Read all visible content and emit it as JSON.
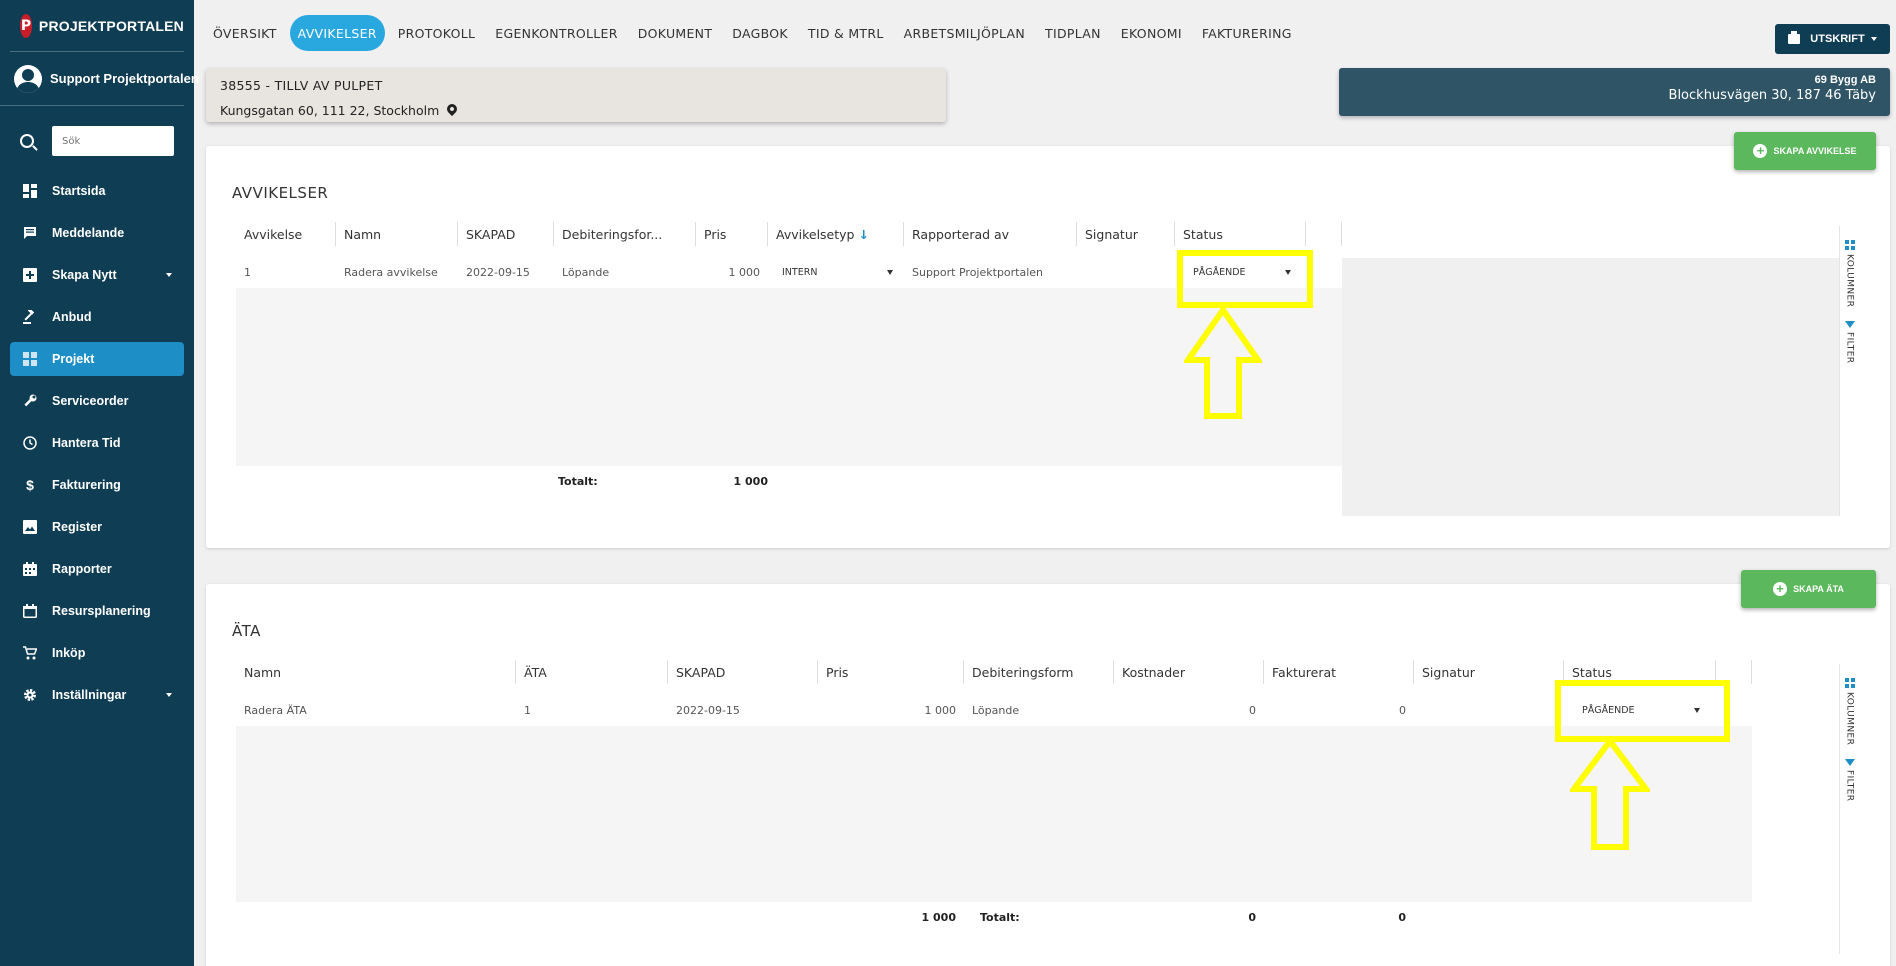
{
  "sidebar": {
    "brand": "PROJEKTPORTALEN",
    "brand_logo": "P",
    "user_name": "Support Projektportalen",
    "search_placeholder": "Sök",
    "items": [
      {
        "label": "Startsida",
        "icon": "dashboard-icon"
      },
      {
        "label": "Meddelande",
        "icon": "message-icon"
      },
      {
        "label": "Skapa Nytt",
        "icon": "add-box-icon",
        "caret": true
      },
      {
        "label": "Anbud",
        "icon": "gavel-icon"
      },
      {
        "label": "Projekt",
        "icon": "project-icon",
        "active": true
      },
      {
        "label": "Serviceorder",
        "icon": "wrench-icon"
      },
      {
        "label": "Hantera Tid",
        "icon": "clock-icon"
      },
      {
        "label": "Fakturering",
        "icon": "dollar-icon"
      },
      {
        "label": "Register",
        "icon": "image-icon"
      },
      {
        "label": "Rapporter",
        "icon": "calendar-grid-icon"
      },
      {
        "label": "Resursplanering",
        "icon": "calendar-icon"
      },
      {
        "label": "Inköp",
        "icon": "cart-icon"
      },
      {
        "label": "Inställningar",
        "icon": "gear-icon",
        "caret": true
      }
    ]
  },
  "topnav": {
    "tabs": [
      "ÖVERSIKT",
      "AVVIKELSER",
      "PROTOKOLL",
      "EGENKONTROLLER",
      "DOKUMENT",
      "DAGBOK",
      "TID & MTRL",
      "ARBETSMILJÖPLAN",
      "TIDPLAN",
      "EKONOMI",
      "FAKTURERING"
    ],
    "active_tab": "AVVIKELSER",
    "print_label": "UTSKRIFT"
  },
  "project": {
    "title": "38555 - TILLV AV PULPET",
    "address": "Kungsgatan 60, 111 22, Stockholm"
  },
  "company": {
    "name": "69 Bygg AB",
    "address": "Blockhusvägen 30, 187 46 Täby"
  },
  "avvikelser": {
    "title": "AVVIKELSER",
    "create_label": "SKAPA AVVIKELSE",
    "columns": [
      "Avvikelse",
      "Namn",
      "SKAPAD",
      "Debiteringsfor...",
      "Pris",
      "Avvikelsetyp",
      "Rapporterad av",
      "Signatur",
      "Status"
    ],
    "sort_arrow": "↓",
    "row": {
      "avvikelse": "1",
      "namn": "Radera avvikelse",
      "skapad": "2022-09-15",
      "debitering": "Löpande",
      "pris": "1 000",
      "typ": "INTERN",
      "rapporterad": "Support Projektportalen",
      "signatur": "",
      "status": "PÅGÅENDE"
    },
    "total_label": "Totalt:",
    "total_value": "1 000"
  },
  "ata": {
    "title": "ÄTA",
    "create_label": "SKAPA ÄTA",
    "columns": [
      "Namn",
      "ÄTA",
      "SKAPAD",
      "Pris",
      "Debiteringsform",
      "Kostnader",
      "Fakturerat",
      "Signatur",
      "Status"
    ],
    "row": {
      "namn": "Radera ÄTA",
      "ata": "1",
      "skapad": "2022-09-15",
      "pris": "1 000",
      "debitering": "Löpande",
      "kostnader": "0",
      "fakturerat": "0",
      "signatur": "",
      "status": "PÅGÅENDE"
    },
    "total_pris": "1 000",
    "total_label": "Totalt:",
    "total_kostnader": "0",
    "total_fakturerat": "0"
  },
  "side_tools": {
    "columns_label": "KOLUMNER",
    "filter_label": "FILTER"
  },
  "colors": {
    "sidebar": "#0f3d54",
    "accent": "#29a8e0",
    "create_button": "#5cb85c",
    "highlight": "#ffff00"
  }
}
